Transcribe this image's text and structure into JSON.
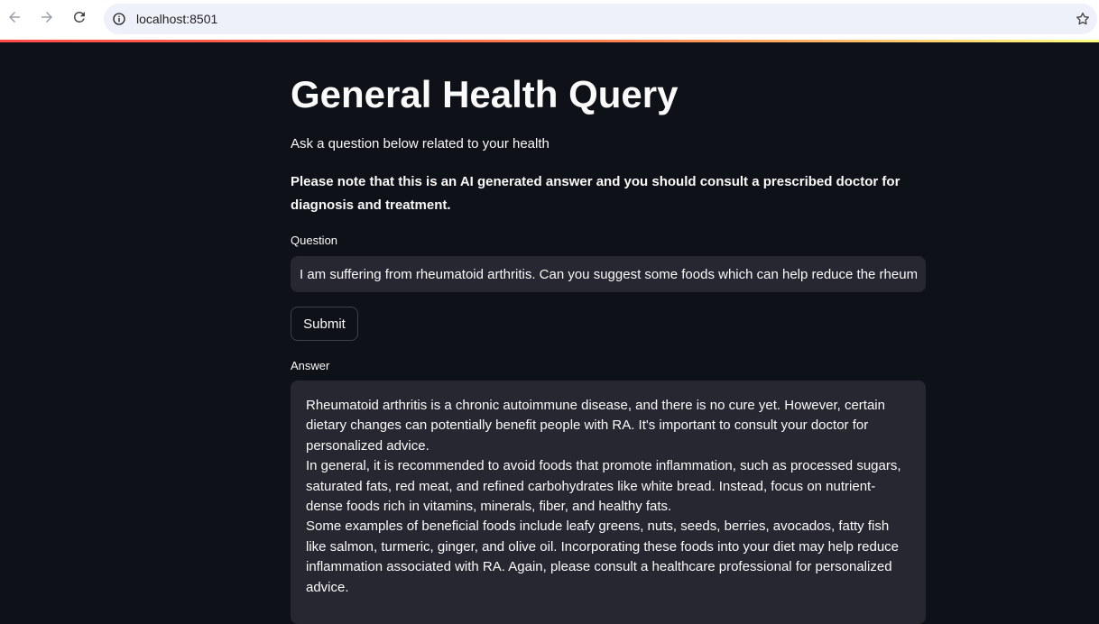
{
  "browser": {
    "url": "localhost:8501",
    "icons": {
      "back": "arrow-left-icon",
      "forward": "arrow-right-icon",
      "reload": "reload-icon",
      "site_info": "info-circle-icon",
      "bookmark": "star-icon"
    }
  },
  "colors": {
    "background": "#0e1117",
    "surface": "#262730",
    "text": "#fafafa",
    "decoration_gradient": [
      "#ff4b4b",
      "#ff7f50",
      "#fffd80"
    ]
  },
  "page": {
    "title": "General Health Query",
    "intro": "Ask a question below related to your health",
    "disclaimer": "Please note that this is an AI generated answer and you should consult a prescribed doctor for diagnosis and treatment.",
    "question_label": "Question",
    "question_value": "I am suffering from rheumatoid arthritis. Can you suggest some foods which can help reduce the rheumatoid arthritis?",
    "submit_label": "Submit",
    "answer_label": "Answer",
    "answer_text": "Rheumatoid arthritis is a chronic autoimmune disease, and there is no cure yet. However, certain dietary changes can potentially benefit people with RA. It's important to consult your doctor for personalized advice.\nIn general, it is recommended to avoid foods that promote inflammation, such as processed sugars, saturated fats, red meat, and refined carbohydrates like white bread. Instead, focus on nutrient-dense foods rich in vitamins, minerals, fiber, and healthy fats.\nSome examples of beneficial foods include leafy greens, nuts, seeds, berries, avocados, fatty fish like salmon, turmeric, ginger, and olive oil. Incorporating these foods into your diet may help reduce inflammation associated with RA. Again, please consult a healthcare professional for personalized advice."
  }
}
